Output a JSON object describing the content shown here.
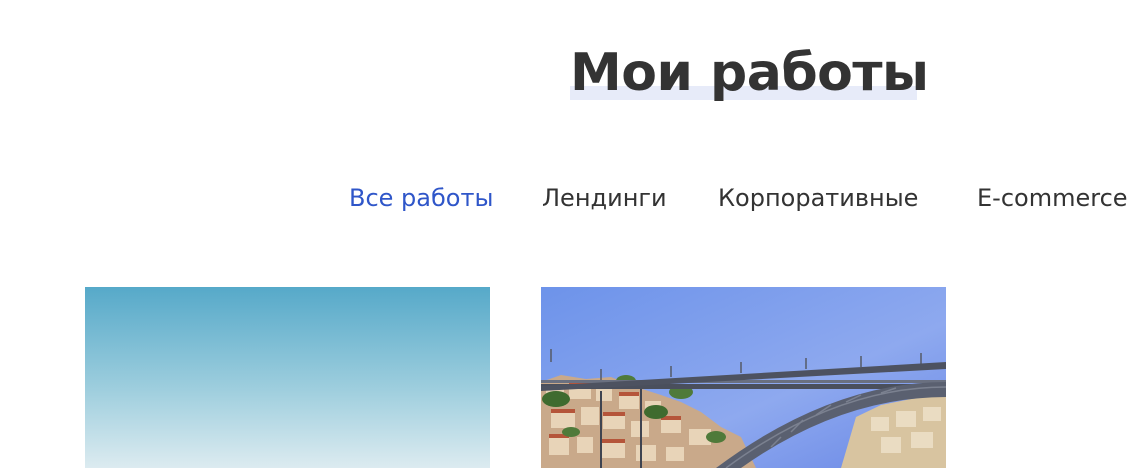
{
  "section": {
    "title": "Мои работы"
  },
  "filters": [
    {
      "label": "Все работы",
      "active": true
    },
    {
      "label": "Лендинги",
      "active": false
    },
    {
      "label": "Корпоративные",
      "active": false
    },
    {
      "label": "E-commerce",
      "active": false
    }
  ],
  "colors": {
    "accent": "#2f56c9",
    "text": "#333333",
    "title_highlight": "#e7ebf9"
  },
  "portfolio": {
    "items": [
      {
        "image": "sky-gradient-photo"
      },
      {
        "image": "arch-bridge-city-photo"
      }
    ]
  }
}
